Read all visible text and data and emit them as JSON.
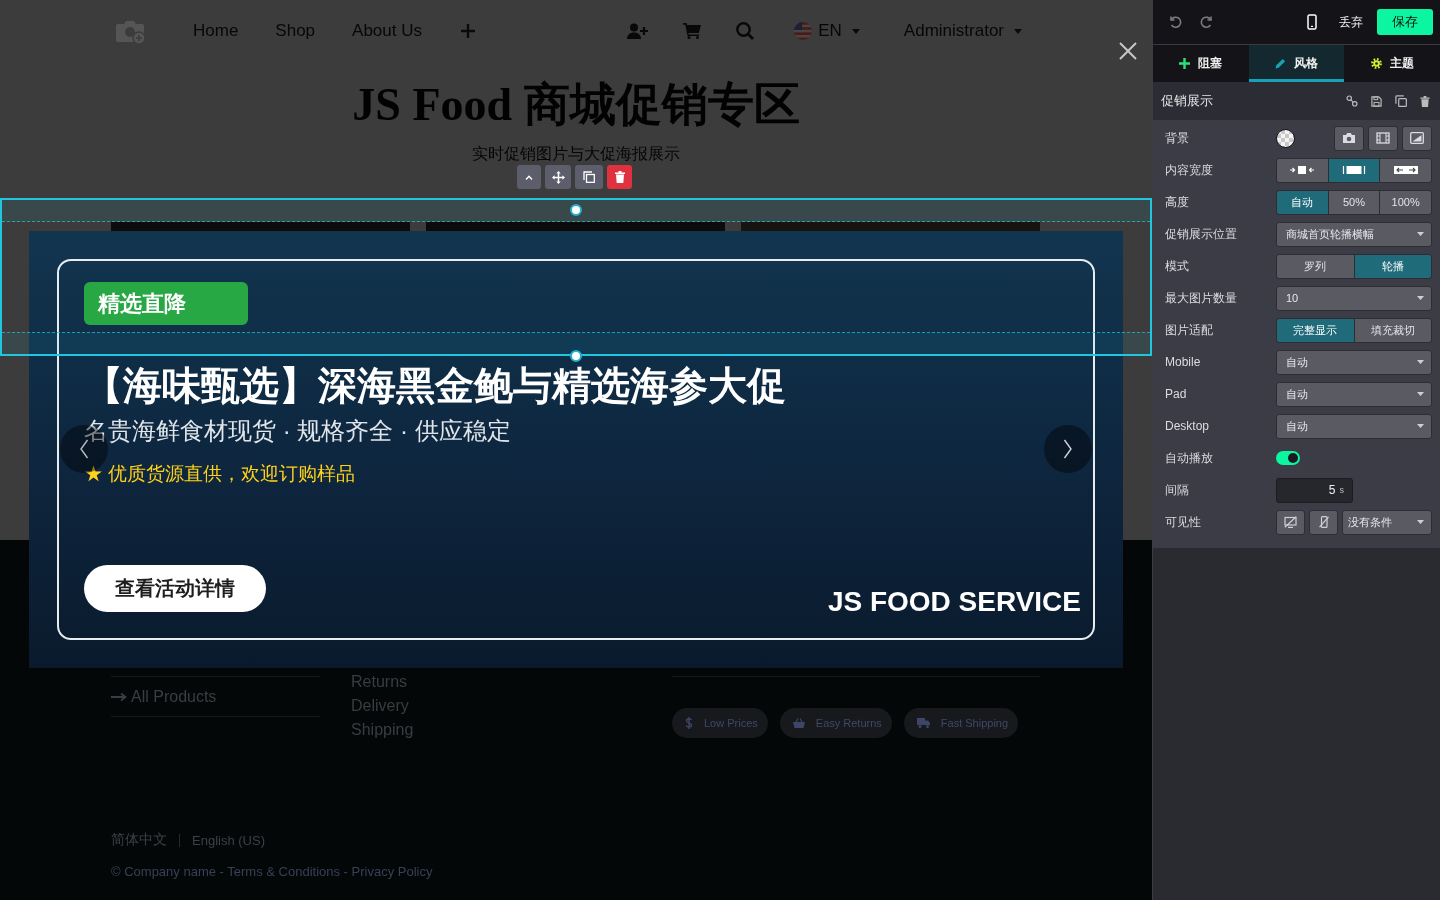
{
  "site": {
    "nav": {
      "links": [
        {
          "label": "Home"
        },
        {
          "label": "Shop"
        },
        {
          "label": "About Us"
        }
      ],
      "language": "EN",
      "user": "Administrator"
    },
    "heading": "JS Food 商城促销专区",
    "subheading": "实时促销图片与大促海报展示",
    "footer": {
      "product_link": "All Products",
      "service_links": [
        "Returns",
        "Delivery",
        "Shipping"
      ],
      "badges": [
        {
          "label": "Low Prices"
        },
        {
          "label": "Easy Returns"
        },
        {
          "label": "Fast Shipping"
        }
      ],
      "languages": [
        "简体中文",
        "English (US)"
      ],
      "copyright": "© Company name - Terms & Conditions - Privacy Policy"
    }
  },
  "lightbox": {
    "tag": "精选直降",
    "headline": "【海味甄选】深海黑金鲍与精选海参大促",
    "subline": "名贵海鲜食材现货 · 规格齐全 · 供应稳定",
    "note": "★ 优质货源直供，欢迎订购样品",
    "button": "查看活动详情",
    "brand": "JS FOOD SERVICE"
  },
  "editor": {
    "discard": "丢弃",
    "save": "保存",
    "tabs": [
      {
        "label": "阻塞",
        "selected": false
      },
      {
        "label": "风格",
        "selected": true
      },
      {
        "label": "主题",
        "selected": false
      }
    ],
    "block_title": "促销展示",
    "options": [
      {
        "kind": "background",
        "label": "背景"
      },
      {
        "kind": "icon_segmented",
        "label": "内容宽度",
        "options": [
          {
            "selected": false
          },
          {
            "selected": true
          },
          {
            "selected": false
          }
        ]
      },
      {
        "kind": "segmented",
        "label": "高度",
        "options": [
          {
            "label": "自动",
            "selected": true
          },
          {
            "label": "50%",
            "selected": false
          },
          {
            "label": "100%",
            "selected": false
          }
        ]
      },
      {
        "kind": "select",
        "label": "促销展示位置",
        "value": "商城首页轮播横幅"
      },
      {
        "kind": "segmented",
        "label": "模式",
        "options": [
          {
            "label": "罗列",
            "selected": false
          },
          {
            "label": "轮播",
            "selected": true
          }
        ]
      },
      {
        "kind": "select",
        "label": "最大图片数量",
        "value": "10"
      },
      {
        "kind": "segmented",
        "label": "图片适配",
        "options": [
          {
            "label": "完整显示",
            "selected": true
          },
          {
            "label": "填充裁切",
            "selected": false
          }
        ]
      },
      {
        "kind": "select",
        "label": "Mobile",
        "value": "自动"
      },
      {
        "kind": "select",
        "label": "Pad",
        "value": "自动"
      },
      {
        "kind": "select",
        "label": "Desktop",
        "value": "自动"
      },
      {
        "kind": "toggle",
        "label": "自动播放",
        "on": true
      },
      {
        "kind": "number",
        "label": "间隔",
        "value": "5",
        "unit": "s"
      },
      {
        "kind": "visibility",
        "label": "可见性",
        "value": "没有条件"
      }
    ]
  }
}
